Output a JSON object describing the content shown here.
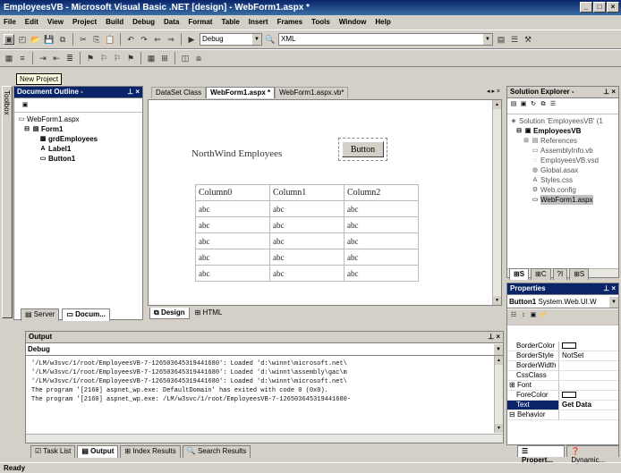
{
  "window": {
    "title": "EmployeesVB - Microsoft Visual Basic .NET [design] - WebForm1.aspx *"
  },
  "menu": [
    "File",
    "Edit",
    "View",
    "Project",
    "Build",
    "Debug",
    "Data",
    "Format",
    "Table",
    "Insert",
    "Frames",
    "Tools",
    "Window",
    "Help"
  ],
  "toolbar": {
    "config": "Debug",
    "target": "XML",
    "tooltip": "New Project"
  },
  "outline": {
    "title": "Document Outline - ",
    "root": "WebForm1.aspx",
    "form": "Form1",
    "items": [
      "grdEmployees",
      "Label1",
      "Button1"
    ],
    "tab_server": "Server",
    "tab_docum": "Docum..."
  },
  "toolbox_label": "Toolbox",
  "editor": {
    "tabs": [
      "DataSet Class",
      "WebForm1.aspx *",
      "WebForm1.aspx.vb*"
    ],
    "label": "NorthWind Employees",
    "button": "Button",
    "columns": [
      "Column0",
      "Column1",
      "Column2"
    ],
    "rows": [
      [
        "abc",
        "abc",
        "abc"
      ],
      [
        "abc",
        "abc",
        "abc"
      ],
      [
        "abc",
        "abc",
        "abc"
      ],
      [
        "abc",
        "abc",
        "abc"
      ],
      [
        "abc",
        "abc",
        "abc"
      ]
    ],
    "tab_design": "Design",
    "tab_html": "HTML"
  },
  "solution": {
    "title": "Solution Explorer - ",
    "items": [
      "Solution 'EmployeesVB' (1",
      "EmployeesVB",
      "References",
      "AssemblyInfo.vb",
      "EmployeesVB.vsd",
      "Global.asax",
      "Styles.css",
      "Web.config",
      "WebForm1.aspx"
    ]
  },
  "properties": {
    "title": "Properties",
    "object": "Button1",
    "object_type": "System.Web.UI.W",
    "rows": [
      {
        "k": "BorderColor",
        "v": ""
      },
      {
        "k": "BorderStyle",
        "v": "NotSet"
      },
      {
        "k": "BorderWidth",
        "v": ""
      },
      {
        "k": "CssClass",
        "v": ""
      },
      {
        "k": "Font",
        "v": ""
      },
      {
        "k": "ForeColor",
        "v": ""
      },
      {
        "k": "Text",
        "v": "Get Data"
      },
      {
        "k": "Behavior",
        "v": ""
      }
    ],
    "tab1": "Propert...",
    "tab2": "Dynamic..."
  },
  "output": {
    "title": "Output",
    "pane": "Debug",
    "lines": [
      "'/LM/w3svc/1/root/EmployeesVB-7-126503645319441680': Loaded 'd:\\winnt\\microsoft.net\\",
      "'/LM/w3svc/1/root/EmployeesVB-7-126503645319441680': Loaded 'd:\\winnt\\assembly\\gac\\m",
      "'/LM/w3svc/1/root/EmployeesVB-7-126503645319441680': Loaded 'd:\\winnt\\microsoft.net\\",
      "The program '[2160] aspnet_wp.exe: DefaultDomain' has exited with code 0 (0x0).",
      "The program '[2160] aspnet_wp.exe: /LM/w3svc/1/root/EmployeesVB-7-126503645319441680-"
    ]
  },
  "bottom_tabs": [
    "Task List",
    "Output",
    "Index Results",
    "Search Results"
  ],
  "status": "Ready"
}
